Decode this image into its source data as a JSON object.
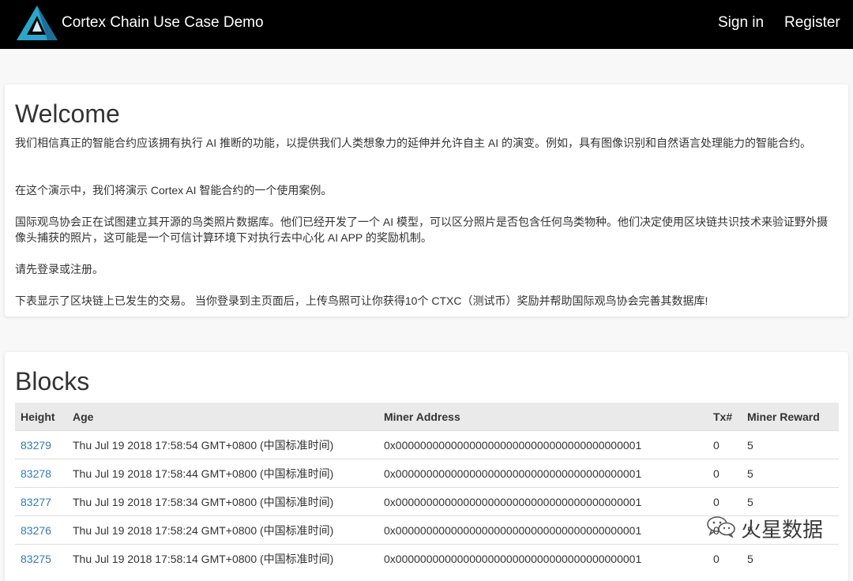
{
  "header": {
    "brand": "Cortex Chain Use Case Demo",
    "sign_in": "Sign in",
    "register": "Register"
  },
  "welcome": {
    "title": "Welcome",
    "p1": "我们相信真正的智能合约应该拥有执行 AI 推断的功能，以提供我们人类想象力的延伸并允许自主 AI 的演变。例如，具有图像识别和自然语言处理能力的智能合约。",
    "p2": "在这个演示中，我们将演示 Cortex AI 智能合约的一个使用案例。",
    "p3": "国际观鸟协会正在试图建立其开源的鸟类照片数据库。他们已经开发了一个 AI 模型，可以区分照片是否包含任何鸟类物种。他们决定使用区块链共识技术来验证野外摄像头捕获的照片，这可能是一个可信计算环境下对执行去中心化 AI APP 的奖励机制。",
    "p4": "请先登录或注册。",
    "p5": "下表显示了区块链上已发生的交易。 当你登录到主页面后，上传鸟照可让你获得10个 CTXC（测试币）奖励并帮助国际观鸟协会完善其数据库!"
  },
  "blocks": {
    "title": "Blocks",
    "columns": [
      "Height",
      "Age",
      "Miner Address",
      "Tx#",
      "Miner Reward"
    ],
    "rows": [
      {
        "height": "83279",
        "age": "Thu Jul 19 2018 17:58:54 GMT+0800 (中国标准时间)",
        "miner": "0x0000000000000000000000000000000000000001",
        "tx": "0",
        "reward": "5"
      },
      {
        "height": "83278",
        "age": "Thu Jul 19 2018 17:58:44 GMT+0800 (中国标准时间)",
        "miner": "0x0000000000000000000000000000000000000001",
        "tx": "0",
        "reward": "5"
      },
      {
        "height": "83277",
        "age": "Thu Jul 19 2018 17:58:34 GMT+0800 (中国标准时间)",
        "miner": "0x0000000000000000000000000000000000000001",
        "tx": "0",
        "reward": "5"
      },
      {
        "height": "83276",
        "age": "Thu Jul 19 2018 17:58:24 GMT+0800 (中国标准时间)",
        "miner": "0x0000000000000000000000000000000000000001",
        "tx": "0",
        "reward": "5"
      },
      {
        "height": "83275",
        "age": "Thu Jul 19 2018 17:58:14 GMT+0800 (中国标准时间)",
        "miner": "0x0000000000000000000000000000000000000001",
        "tx": "0",
        "reward": "5"
      }
    ]
  },
  "watermark": {
    "text": "火星数据",
    "icon": "wechat-icon"
  },
  "colors": {
    "navbar": "#000000",
    "link": "#337ab7",
    "logo_teal": "#2aa6c8"
  }
}
